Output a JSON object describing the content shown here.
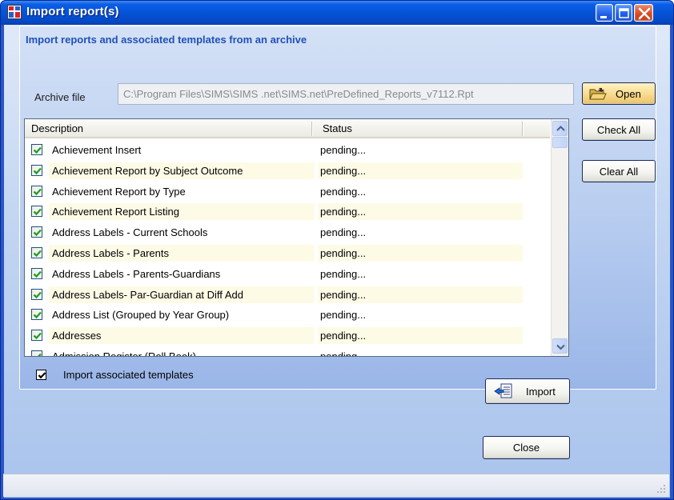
{
  "window": {
    "title": "Import report(s)"
  },
  "panel": {
    "heading": "Import reports and associated templates from an archive",
    "archive_label": "Archive file",
    "archive_value": "C:\\Program Files\\SIMS\\SIMS .net\\SIMS.net\\PreDefined_Reports_v7112.Rpt",
    "open_label": "Open"
  },
  "list": {
    "columns": [
      "Description",
      "Status"
    ],
    "rows": [
      {
        "description": "Achievement Insert",
        "status": "pending..."
      },
      {
        "description": "Achievement Report by Subject Outcome",
        "status": "pending..."
      },
      {
        "description": "Achievement Report by Type",
        "status": "pending..."
      },
      {
        "description": "Achievement Report Listing",
        "status": "pending..."
      },
      {
        "description": "Address Labels - Current Schools",
        "status": "pending..."
      },
      {
        "description": "Address Labels - Parents",
        "status": "pending..."
      },
      {
        "description": "Address Labels - Parents-Guardians",
        "status": "pending..."
      },
      {
        "description": "Address Labels- Par-Guardian at Diff Add",
        "status": "pending..."
      },
      {
        "description": "Address List (Grouped by Year Group)",
        "status": "pending..."
      },
      {
        "description": "Addresses",
        "status": "pending..."
      },
      {
        "description": "Admission Register (Roll Book)",
        "status": "pending..."
      }
    ]
  },
  "buttons": {
    "check_all": "Check All",
    "clear_all": "Clear All",
    "import": "Import",
    "close": "Close"
  },
  "options": {
    "import_templates_label": "Import associated templates",
    "import_templates_checked": true
  },
  "colors": {
    "title_bar": "#0553d6",
    "heading": "#2050b8",
    "row_alt": "#fdfbe6",
    "check": "#21a121"
  }
}
